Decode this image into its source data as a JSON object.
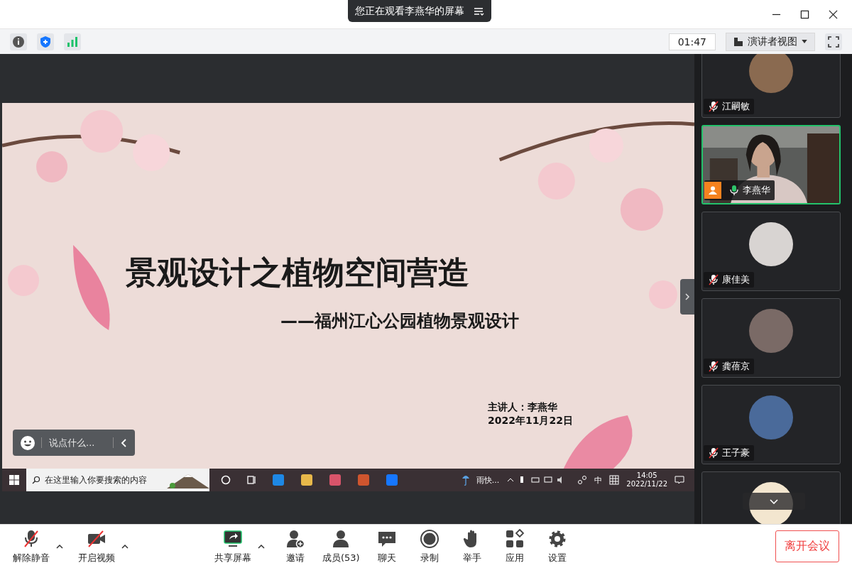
{
  "window": {
    "banner": "您正在观看李燕华的屏幕"
  },
  "toolbar": {
    "timer": "01:47",
    "view_mode": "演讲者视图"
  },
  "slide": {
    "title": "景观设计之植物空间营造",
    "subtitle": "——福州江心公园植物景观设计",
    "presenter": "主讲人：李燕华",
    "date": "2022年11月22日"
  },
  "chat_bar": {
    "placeholder": "说点什么..."
  },
  "taskbar": {
    "search_placeholder": "在这里输入你要搜索的内容",
    "weather": "雨快...",
    "ime": "中",
    "time": "14:05",
    "date": "2022/11/22"
  },
  "participants": [
    {
      "name": "江嗣敏",
      "kind": "avatar",
      "muted": true,
      "speaking": false,
      "host": false,
      "color": "#8a6a50"
    },
    {
      "name": "李燕华",
      "kind": "video",
      "muted": false,
      "speaking": true,
      "host": true
    },
    {
      "name": "康佳美",
      "kind": "avatar",
      "muted": true,
      "speaking": false,
      "host": false,
      "color": "#d8d4d2"
    },
    {
      "name": "龚蓓京",
      "kind": "avatar",
      "muted": true,
      "speaking": false,
      "host": false,
      "color": "#7a6a66"
    },
    {
      "name": "王子豪",
      "kind": "avatar",
      "muted": true,
      "speaking": false,
      "host": false,
      "color": "#4a6a9a"
    },
    {
      "kind": "avatar",
      "speaking": false,
      "color": "#f3e6cf"
    }
  ],
  "controls": [
    {
      "label": "解除静音",
      "kind": "mic",
      "menu": true
    },
    {
      "label": "开启视频",
      "kind": "camera",
      "menu": true
    },
    {
      "label": "共享屏幕",
      "kind": "share",
      "menu": true
    },
    {
      "label": "邀请",
      "kind": "invite",
      "menu": false
    },
    {
      "label": "成员(53)",
      "kind": "members",
      "menu": false
    },
    {
      "label": "聊天",
      "kind": "chat",
      "menu": false
    },
    {
      "label": "录制",
      "kind": "record",
      "menu": false
    },
    {
      "label": "举手",
      "kind": "hand",
      "menu": false
    },
    {
      "label": "应用",
      "kind": "apps",
      "menu": false
    },
    {
      "label": "设置",
      "kind": "settings",
      "menu": false
    }
  ],
  "leave_button": "离开会议"
}
